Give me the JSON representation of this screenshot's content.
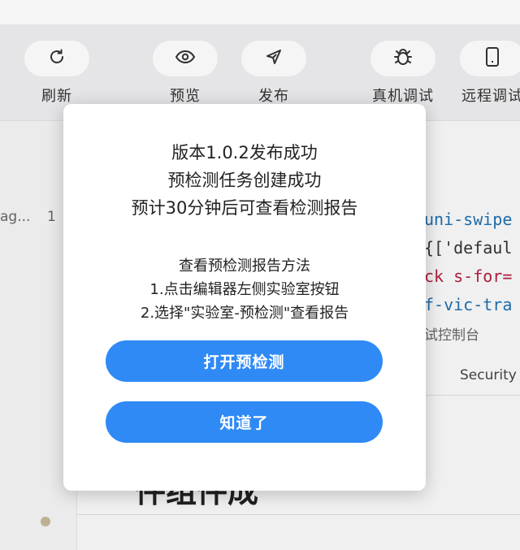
{
  "toolbar": {
    "items": [
      {
        "label": "刷新",
        "icon": "refresh-icon"
      },
      {
        "label": "预览",
        "icon": "eye-icon"
      },
      {
        "label": "发布",
        "icon": "paper-plane-icon"
      },
      {
        "label": "真机调试",
        "icon": "bug-icon"
      },
      {
        "label": "远程调试",
        "icon": "phone-icon"
      }
    ]
  },
  "sidebar": {
    "row_text": "ag...",
    "row_count": "1"
  },
  "editor": {
    "code_lines": [
      {
        "text": "uni-swipe",
        "color": "#1f6fb0"
      },
      {
        "text": "{['defaul",
        "color": "#333333"
      },
      {
        "text": "ck s-for=",
        "color": "#b2203f"
      },
      {
        "text": "f-vic-tra",
        "color": "#1f6fb0"
      }
    ],
    "console_label": "试控制台",
    "security_tab": "Security"
  },
  "background": {
    "heading": "件组件成"
  },
  "dialog": {
    "lines": [
      "版本1.0.2发布成功",
      "预检测任务创建成功",
      "预计30分钟后可查看检测报告"
    ],
    "hint_title": "查看预检测报告方法",
    "hint_steps": [
      "1.点击编辑器左侧实验室按钮",
      "2.选择\"实验室-预检测\"查看报告"
    ],
    "primary_button": "打开预检测",
    "secondary_button": "知道了"
  },
  "colors": {
    "accent": "#2f8af5",
    "dialog_bg": "#ffffff",
    "toolbar_bg": "#efeff1"
  }
}
